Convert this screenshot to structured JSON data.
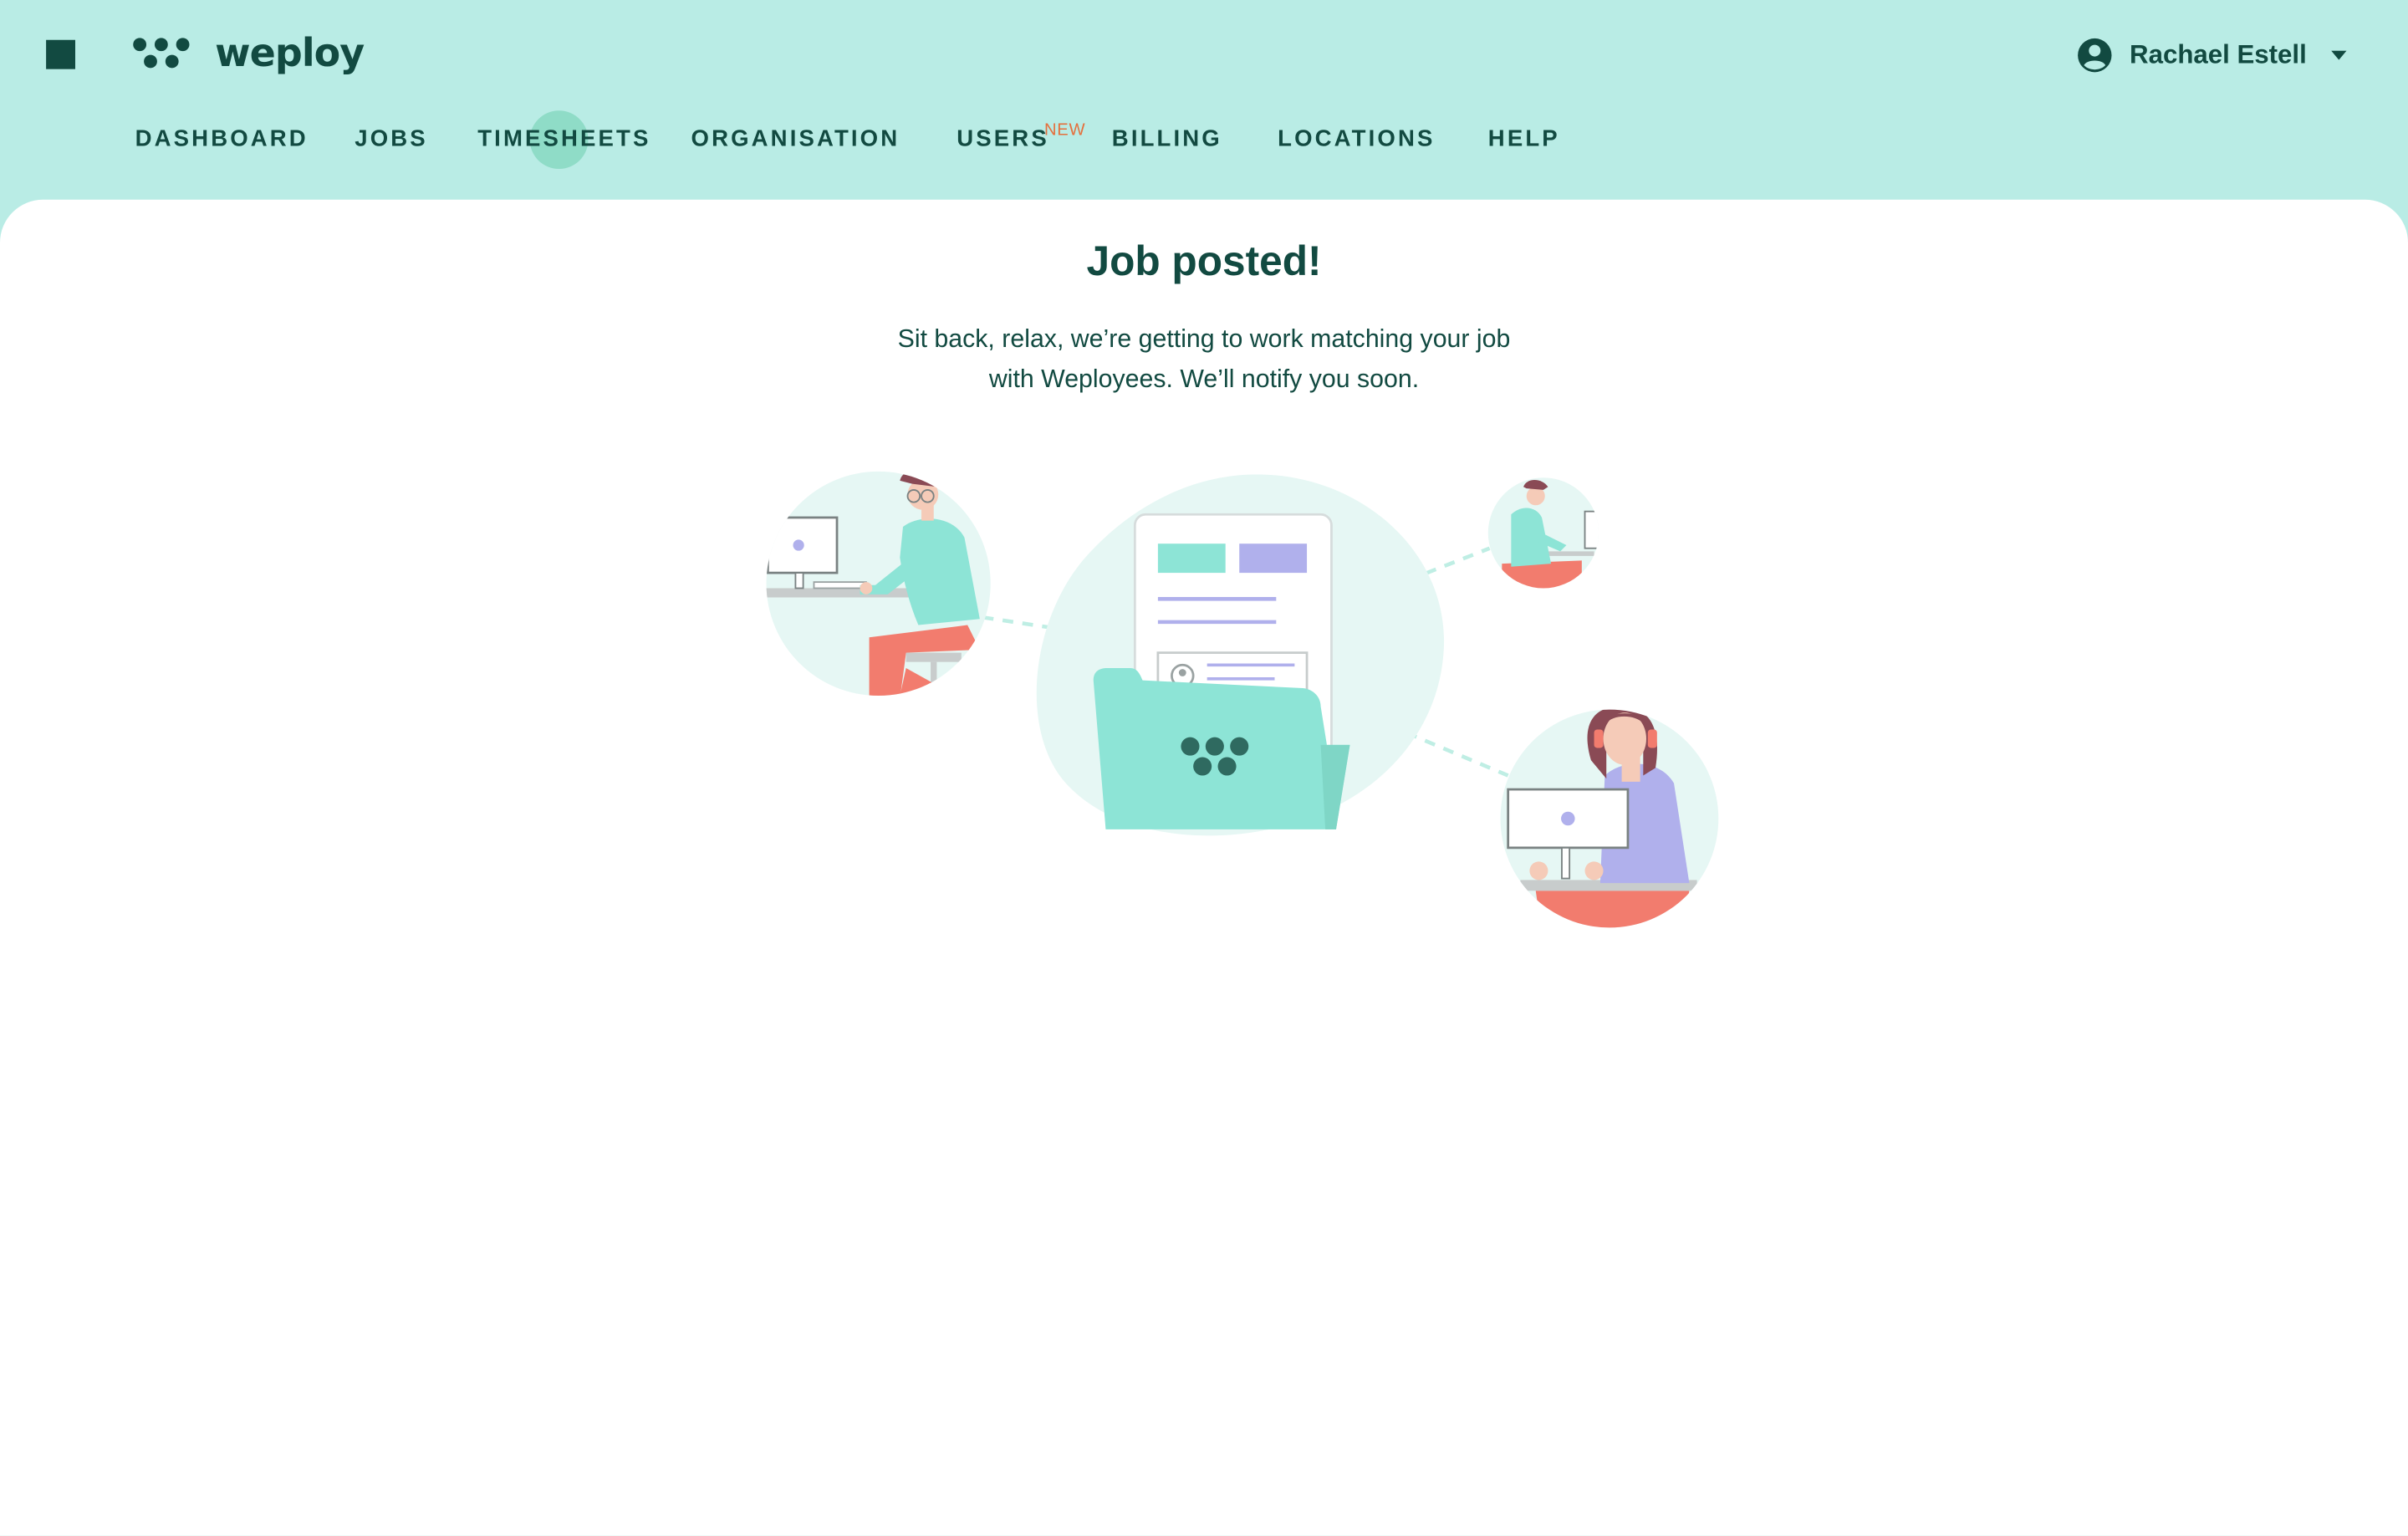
{
  "app": {
    "logo_text": "weploy"
  },
  "user": {
    "name": "Rachael Estell"
  },
  "nav": {
    "items": [
      {
        "label": "DASHBOARD"
      },
      {
        "label": "JOBS"
      },
      {
        "label": "TIMESHEETS"
      },
      {
        "label": "ORGANISATION"
      },
      {
        "label": "USERS"
      },
      {
        "label": "BILLING"
      },
      {
        "label": "LOCATIONS"
      },
      {
        "label": "HELP"
      }
    ],
    "new_badge": "NEW"
  },
  "main": {
    "title": "Job posted!",
    "subtitle": "Sit back, relax, we’re getting to work matching your job with Weployees. We’ll notify you soon."
  },
  "icons": {
    "menu": "menu-icon",
    "logo_mark": "weploy-logo-icon",
    "user": "account-circle-icon",
    "caret": "caret-down-icon"
  },
  "colors": {
    "header_bg": "#b9ece5",
    "primary_text": "#124a41",
    "accent_mint": "#8de4d6",
    "accent_lavender": "#b0b0ec",
    "accent_coral": "#f27c6e",
    "new_badge": "#e4703d"
  }
}
